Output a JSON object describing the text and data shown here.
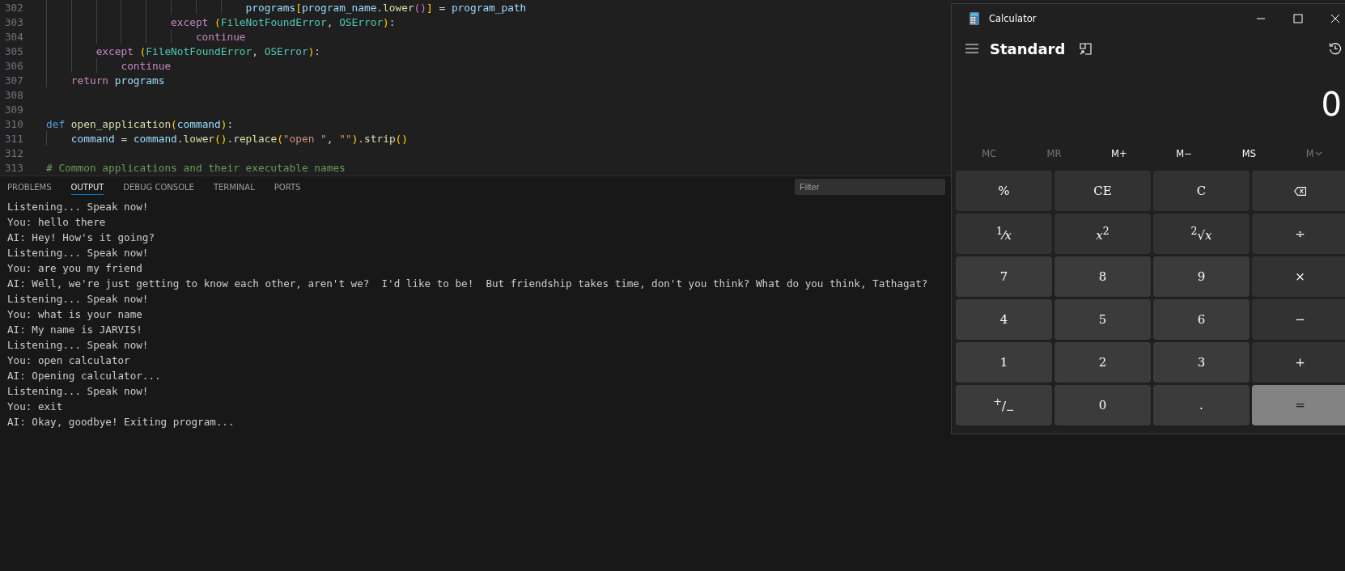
{
  "editor": {
    "lines": [
      {
        "number": "302",
        "tokens": [
          {
            "kind": "var",
            "text": "                                programs"
          },
          {
            "kind": "paren",
            "text": "["
          },
          {
            "kind": "var",
            "text": "program_name"
          },
          {
            "kind": "plain",
            "text": "."
          },
          {
            "kind": "func",
            "text": "lower"
          },
          {
            "kind": "paren2",
            "text": "()"
          },
          {
            "kind": "paren",
            "text": "]"
          },
          {
            "kind": "plain",
            "text": " = "
          },
          {
            "kind": "var",
            "text": "program_path"
          }
        ]
      },
      {
        "number": "303",
        "tokens": [
          {
            "kind": "ctrl",
            "text": "                    except "
          },
          {
            "kind": "paren",
            "text": "("
          },
          {
            "kind": "type",
            "text": "FileNotFoundError"
          },
          {
            "kind": "plain",
            "text": ", "
          },
          {
            "kind": "type",
            "text": "OSError"
          },
          {
            "kind": "paren",
            "text": ")"
          },
          {
            "kind": "plain",
            "text": ":"
          }
        ]
      },
      {
        "number": "304",
        "tokens": [
          {
            "kind": "ctrl",
            "text": "                        continue"
          }
        ]
      },
      {
        "number": "305",
        "tokens": [
          {
            "kind": "ctrl",
            "text": "        except "
          },
          {
            "kind": "paren",
            "text": "("
          },
          {
            "kind": "type",
            "text": "FileNotFoundError"
          },
          {
            "kind": "plain",
            "text": ", "
          },
          {
            "kind": "type",
            "text": "OSError"
          },
          {
            "kind": "paren",
            "text": ")"
          },
          {
            "kind": "plain",
            "text": ":"
          }
        ]
      },
      {
        "number": "306",
        "tokens": [
          {
            "kind": "ctrl",
            "text": "            continue"
          }
        ]
      },
      {
        "number": "307",
        "tokens": [
          {
            "kind": "ctrl",
            "text": "    return "
          },
          {
            "kind": "var",
            "text": "programs"
          }
        ]
      },
      {
        "number": "308"
      },
      {
        "number": "309"
      },
      {
        "number": "310",
        "tokens": [
          {
            "kind": "keyword",
            "text": "def "
          },
          {
            "kind": "func",
            "text": "open_application"
          },
          {
            "kind": "paren",
            "text": "("
          },
          {
            "kind": "var",
            "text": "command"
          },
          {
            "kind": "paren",
            "text": ")"
          },
          {
            "kind": "plain",
            "text": ":"
          }
        ]
      },
      {
        "number": "311",
        "tokens": [
          {
            "kind": "var",
            "text": "    command"
          },
          {
            "kind": "plain",
            "text": " = "
          },
          {
            "kind": "var",
            "text": "command"
          },
          {
            "kind": "plain",
            "text": "."
          },
          {
            "kind": "func",
            "text": "lower"
          },
          {
            "kind": "paren",
            "text": "()"
          },
          {
            "kind": "plain",
            "text": "."
          },
          {
            "kind": "func",
            "text": "replace"
          },
          {
            "kind": "paren",
            "text": "("
          },
          {
            "kind": "string",
            "text": "\"open \""
          },
          {
            "kind": "plain",
            "text": ", "
          },
          {
            "kind": "string",
            "text": "\"\""
          },
          {
            "kind": "paren",
            "text": ")"
          },
          {
            "kind": "plain",
            "text": "."
          },
          {
            "kind": "func",
            "text": "strip"
          },
          {
            "kind": "paren",
            "text": "()"
          }
        ]
      },
      {
        "number": "312"
      },
      {
        "number": "313",
        "tokens": [
          {
            "kind": "comment",
            "text": "# Common applications and their executable names"
          }
        ]
      }
    ]
  },
  "panel": {
    "tabs": [
      {
        "label": "PROBLEMS",
        "selected": false
      },
      {
        "label": "OUTPUT",
        "selected": true
      },
      {
        "label": "DEBUG CONSOLE",
        "selected": false
      },
      {
        "label": "TERMINAL",
        "selected": false
      },
      {
        "label": "PORTS",
        "selected": false
      }
    ],
    "filter": {
      "placeholder": "Filter"
    },
    "output": [
      "Listening... Speak now!",
      "You: hello there",
      "AI: Hey! How's it going?",
      "Listening... Speak now!",
      "You: are you my friend",
      "AI: Well, we're just getting to know each other, aren't we?  I'd like to be!  But friendship takes time, don't you think? What do you think, Tathagat?",
      "Listening... Speak now!",
      "You: what is your name",
      "AI: My name is JARVIS!",
      "Listening... Speak now!",
      "You: open calculator",
      "AI: Opening calculator...",
      "Listening... Speak now!",
      "You: exit",
      "AI: Okay, goodbye! Exiting program..."
    ]
  },
  "calculator": {
    "title": "Calculator",
    "mode": "Standard",
    "display": "0",
    "memory": [
      {
        "label": "MC",
        "disabled": true,
        "kind": "plain"
      },
      {
        "label": "MR",
        "disabled": true,
        "kind": "plain"
      },
      {
        "label": "M+",
        "disabled": false,
        "kind": "plain"
      },
      {
        "label": "M−",
        "disabled": false,
        "kind": "plain"
      },
      {
        "label": "MS",
        "disabled": false,
        "kind": "plain"
      },
      {
        "label": "M",
        "disabled": true,
        "kind": "dropdown"
      }
    ],
    "keys": [
      {
        "label": "%",
        "kind": "op"
      },
      {
        "label": "CE",
        "kind": "op"
      },
      {
        "label": "C",
        "kind": "op"
      },
      {
        "kind": "backspace"
      },
      {
        "label": "$^{1}$⁄*x*",
        "kind": "op"
      },
      {
        "label": "*x*$^{2}$",
        "kind": "op"
      },
      {
        "label": "$^{2}$√*x*",
        "kind": "op"
      },
      {
        "label": "÷",
        "kind": "op"
      },
      {
        "label": "7",
        "kind": "digit"
      },
      {
        "label": "8",
        "kind": "digit"
      },
      {
        "label": "9",
        "kind": "digit"
      },
      {
        "label": "×",
        "kind": "op"
      },
      {
        "label": "4",
        "kind": "digit"
      },
      {
        "label": "5",
        "kind": "digit"
      },
      {
        "label": "6",
        "kind": "digit"
      },
      {
        "label": "−",
        "kind": "op"
      },
      {
        "label": "1",
        "kind": "digit"
      },
      {
        "label": "2",
        "kind": "digit"
      },
      {
        "label": "3",
        "kind": "digit"
      },
      {
        "label": "+",
        "kind": "op"
      },
      {
        "label": "$^{+}$/$_{−}$",
        "kind": "digit"
      },
      {
        "label": "0",
        "kind": "digit"
      },
      {
        "label": ".",
        "kind": "digit"
      },
      {
        "label": "=",
        "kind": "equals"
      }
    ]
  }
}
